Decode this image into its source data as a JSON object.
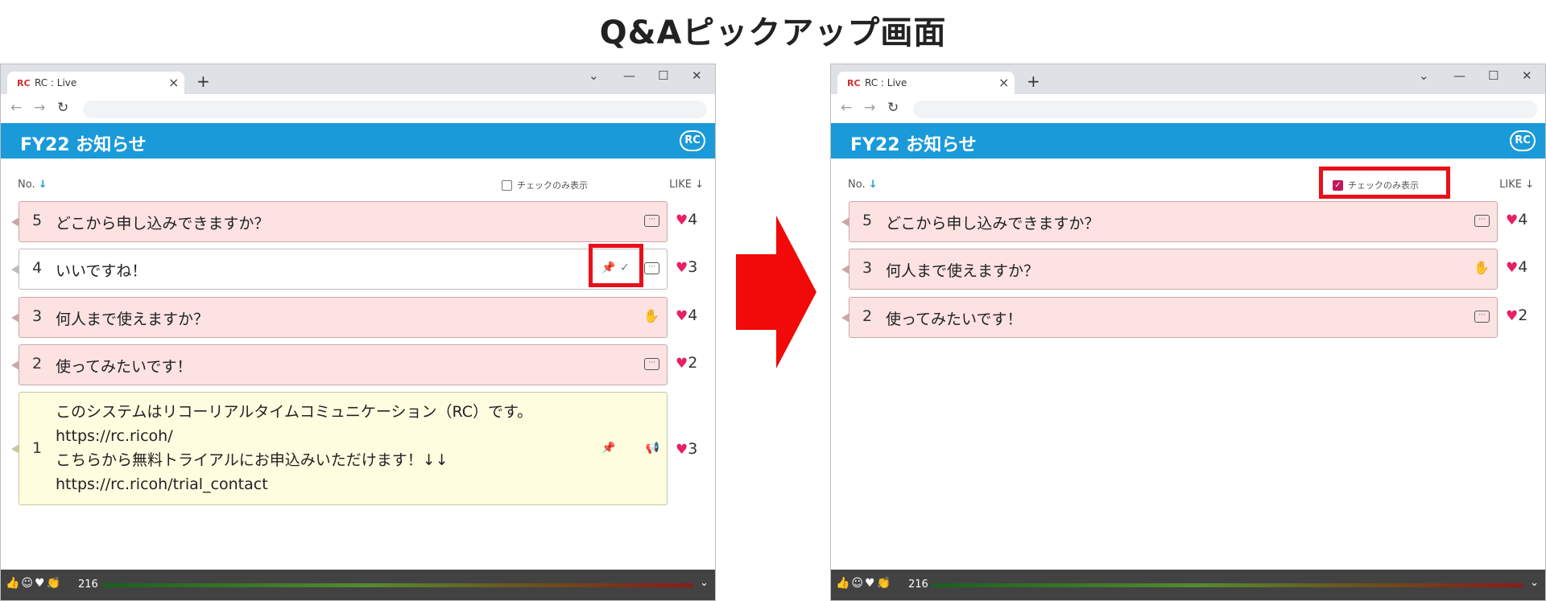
{
  "page_title": "Q&Aピックアップ画面",
  "colors": {
    "accent": "#1a9ad9",
    "highlight": "#e8101a",
    "heart": "#e91e63"
  },
  "browser": {
    "tab_favicon": "RC",
    "tab_title": "RC : Live",
    "tab_close": "×",
    "new_tab": "+",
    "win_menu": "⌄",
    "win_min": "—",
    "win_max": "☐",
    "win_close": "✕",
    "nav_back": "←",
    "nav_forward": "→",
    "nav_reload": "↻"
  },
  "app": {
    "title": "FY22 お知らせ",
    "logo": "RC",
    "col_no_label": "No.",
    "col_like_label": "LIKE",
    "sort_arrow": "↓",
    "check_only_label": "チェックのみ表示"
  },
  "left_panel": {
    "check_only_checked": false,
    "cards": [
      {
        "no": "5",
        "text": "どこから申し込みできますか？",
        "icon": "comment-icon",
        "likes": "4"
      },
      {
        "no": "4",
        "text": "いいですね！",
        "icon": "comment-icon",
        "likes": "3"
      },
      {
        "no": "3",
        "text": "何人まで使えますか？",
        "icon": "hand-icon",
        "likes": "4"
      },
      {
        "no": "2",
        "text": "使ってみたいです！",
        "icon": "comment-icon",
        "likes": "2"
      },
      {
        "no": "1",
        "lines": [
          "このシステムはリコーリアルタイムコミュニケーション（RC）です。",
          "https://rc.ricoh/",
          "こちらから無料トライアルにお申込みいただけます！↓↓",
          "https://rc.ricoh/trial_contact"
        ],
        "icon": "megaphone-icon",
        "likes": "3"
      }
    ]
  },
  "right_panel": {
    "check_only_checked": true,
    "cards": [
      {
        "no": "5",
        "text": "どこから申し込みできますか？",
        "icon": "comment-icon",
        "likes": "4"
      },
      {
        "no": "3",
        "text": "何人まで使えますか？",
        "icon": "hand-icon",
        "likes": "4"
      },
      {
        "no": "2",
        "text": "使ってみたいです！",
        "icon": "comment-icon",
        "likes": "2"
      }
    ]
  },
  "bottom_bar": {
    "reaction_icons": "👍☺♥👏",
    "reaction_count": "216",
    "expand_icon": "⌄"
  },
  "glyphs": {
    "heart": "♥",
    "pin": "📌",
    "check": "✓",
    "comment": "···",
    "hand": "✋",
    "megaphone": "📢"
  }
}
